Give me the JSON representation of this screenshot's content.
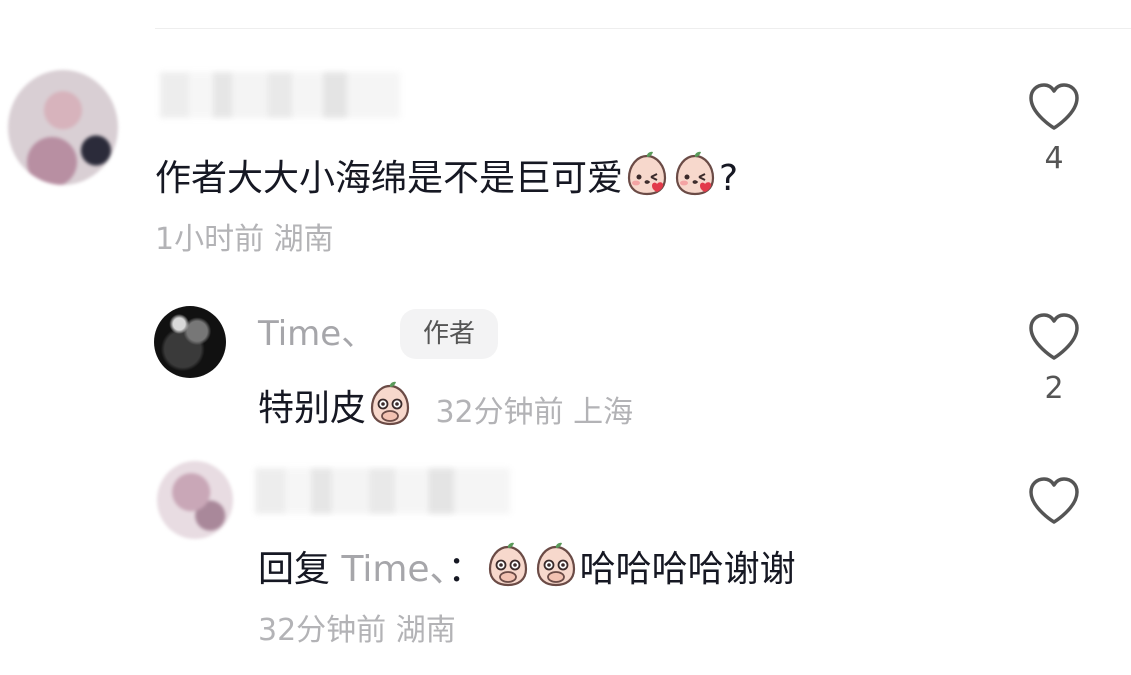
{
  "comments": [
    {
      "text": "作者大大小海绵是不是巨可爱",
      "suffix": "?",
      "emoji": [
        "blushing-peach-emoji",
        "blushing-peach-emoji"
      ],
      "meta": "1小时前 湖南",
      "likes": "4"
    }
  ],
  "replies": [
    {
      "username": "Time、",
      "badge": "作者",
      "text": "特别皮",
      "emoji": [
        "covering-mouth-peach-emoji"
      ],
      "meta": "32分钟前 上海",
      "likes": "2"
    },
    {
      "prefix": "回复 ",
      "reply_to": "Time、",
      "colon": "：",
      "emoji": [
        "covering-mouth-peach-emoji",
        "covering-mouth-peach-emoji"
      ],
      "text": "哈哈哈哈谢谢",
      "meta": "32分钟前 湖南"
    }
  ],
  "icons": {
    "like": "heart-outline-icon"
  },
  "colors": {
    "text": "#161823",
    "meta": "#b3b3b6",
    "username": "#a6a6aa",
    "badge_bg": "#f3f3f4"
  }
}
